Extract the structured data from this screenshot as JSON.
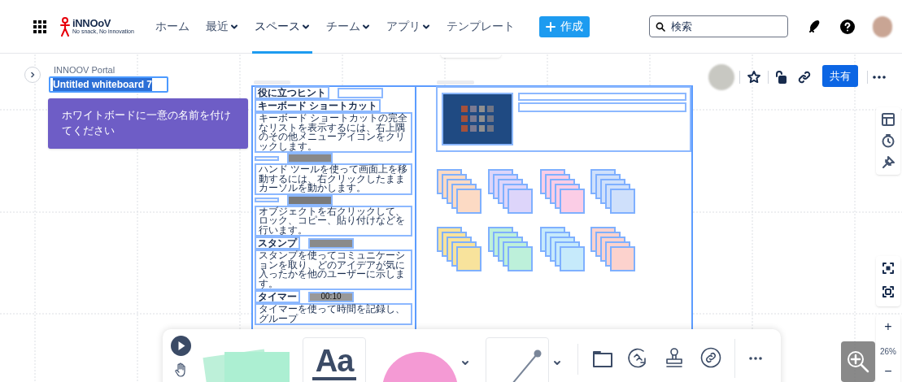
{
  "nav": {
    "logo_text": "iNNOoV",
    "logo_tagline": "No snack, No innovation",
    "items": [
      {
        "label": "ホーム",
        "has_menu": false,
        "selected": false
      },
      {
        "label": "最近",
        "has_menu": true,
        "selected": false
      },
      {
        "label": "スペース",
        "has_menu": true,
        "selected": true
      },
      {
        "label": "チーム",
        "has_menu": true,
        "selected": false
      },
      {
        "label": "アプリ",
        "has_menu": true,
        "selected": false
      },
      {
        "label": "テンプレート",
        "has_menu": false,
        "selected": false
      }
    ],
    "create_button": "作成",
    "search": {
      "placeholder": "検索"
    }
  },
  "board": {
    "space": "INNOOV Portal",
    "title": "Untitled whiteboard 7",
    "hint": "ホワイトボードに一意の名前を付けてください",
    "share_button": "共有",
    "starred": false
  },
  "tips": [
    {
      "kind": "title",
      "text": "役に立つヒント"
    },
    {
      "kind": "heading",
      "text": "キーボード ショートカット"
    },
    {
      "kind": "body",
      "text": "キーボード ショートカットの完全なリストを表示するには、右上隅のその他メニューアイコンをクリックします。"
    },
    {
      "kind": "blank"
    },
    {
      "kind": "body",
      "text": "ハンド ツールを使って画面上を移動するには、右クリックしたままカーソルを動かします。"
    },
    {
      "kind": "blank"
    },
    {
      "kind": "body",
      "text": "オブジェクトを右クリックして、ロック、コピー、貼り付けなどを行います。"
    },
    {
      "kind": "heading",
      "text": "スタンプ"
    },
    {
      "kind": "body",
      "text": "スタンプを使ってコミュニケーションを取り、どのアイデアが気に入ったかを他のユーザーに示します。"
    },
    {
      "kind": "heading",
      "text": "タイマー"
    },
    {
      "kind": "body",
      "text": "タイマーを使って時間を記録し、グループ"
    }
  ],
  "timer_reading": "00:10",
  "sticky_stacks": [
    {
      "color": "#fcdac4"
    },
    {
      "color": "#ddd5fa"
    },
    {
      "color": "#fbcde6"
    },
    {
      "color": "#cfe0fb"
    },
    {
      "color": "#f8e39c"
    },
    {
      "color": "#bdf0da"
    },
    {
      "color": "#c6eafb"
    },
    {
      "color": "#fcd2cd"
    }
  ],
  "toolbar": {
    "text_tool": "Aa"
  },
  "zoom": {
    "plus": "+",
    "level": "26%",
    "minus": "−"
  }
}
